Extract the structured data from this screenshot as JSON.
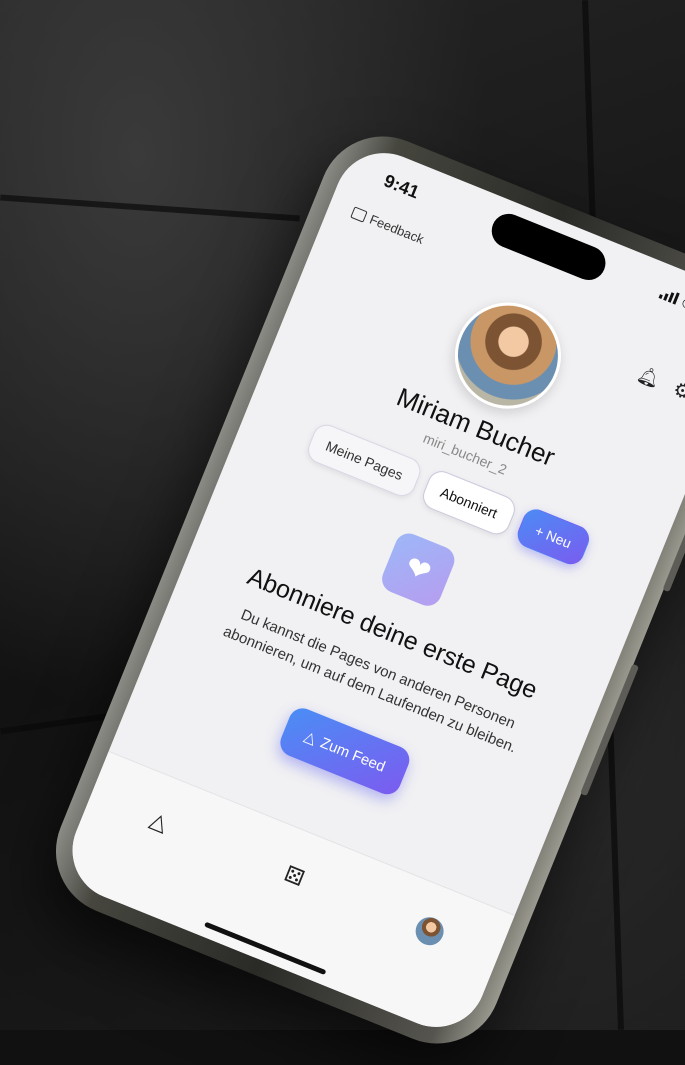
{
  "status_bar": {
    "time": "9:41"
  },
  "header": {
    "feedback_label": "Feedback",
    "icons": [
      "bell-icon",
      "gear-icon"
    ]
  },
  "profile": {
    "name": "Miriam Bucher",
    "handle": "miri_bucher_2"
  },
  "tabs": [
    {
      "label": "Meine Pages",
      "active": false
    },
    {
      "label": "Abonniert",
      "active": true
    }
  ],
  "new_button_label": "+ Neu",
  "empty_state": {
    "icon": "heart-icon",
    "title": "Abonniere deine erste Page",
    "text": "Du kannst die Pages von anderen Personen abonnieren, um auf dem Laufenden zu bleiben.",
    "button_label": "Zum Feed"
  },
  "bottom_nav": [
    {
      "icon": "triangle-graph-icon"
    },
    {
      "icon": "dice-icon"
    },
    {
      "icon": "avatar"
    }
  ],
  "colors": {
    "accent_start": "#4a8ef5",
    "accent_end": "#7c5bf0",
    "screen_bg": "#f1f1f3"
  }
}
